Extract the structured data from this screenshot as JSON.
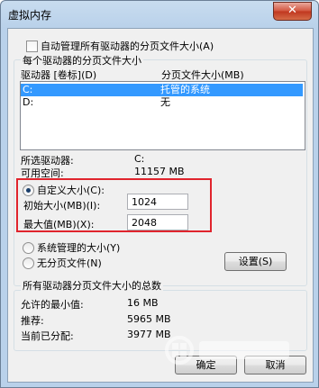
{
  "window": {
    "title": "虚拟内存",
    "close_glyph": "✕"
  },
  "auto_manage": {
    "label": "自动管理所有驱动器的分页文件大小(A)",
    "checked": false
  },
  "per_drive_group": {
    "legend": "每个驱动器的分页文件大小"
  },
  "list": {
    "col_drive": "驱动器 [卷标](D)",
    "col_size": "分页文件大小(MB)",
    "rows": [
      {
        "drive": "C:",
        "size": "托管的系统",
        "selected": true
      },
      {
        "drive": "D:",
        "size": "无",
        "selected": false
      }
    ]
  },
  "selected_drive": {
    "label": "所选驱动器:",
    "value": "C:"
  },
  "free_space": {
    "label": "可用空间:",
    "value": "11157 MB"
  },
  "custom_size": {
    "label": "自定义大小(C):",
    "checked": true
  },
  "initial_size": {
    "label": "初始大小(MB)(I):",
    "value": "1024"
  },
  "max_size": {
    "label": "最大值(MB)(X):",
    "value": "2048"
  },
  "system_managed": {
    "label": "系统管理的大小(Y)",
    "checked": false
  },
  "no_paging": {
    "label": "无分页文件(N)",
    "checked": false
  },
  "set_button": {
    "label": "设置(S)"
  },
  "totals_group": {
    "legend": "所有驱动器分页文件大小的总数"
  },
  "totals": [
    {
      "label": "允许的最小值:",
      "value": "16 MB"
    },
    {
      "label": "推荐:",
      "value": "5965 MB"
    },
    {
      "label": "当前已分配:",
      "value": "3977 MB"
    }
  ],
  "bottom_buttons": {
    "ok": "确定",
    "cancel": "取消"
  },
  "colors": {
    "highlight": "#3399ff",
    "annotation_box": "#e0242d",
    "title_bg": "#b9d1ea"
  }
}
